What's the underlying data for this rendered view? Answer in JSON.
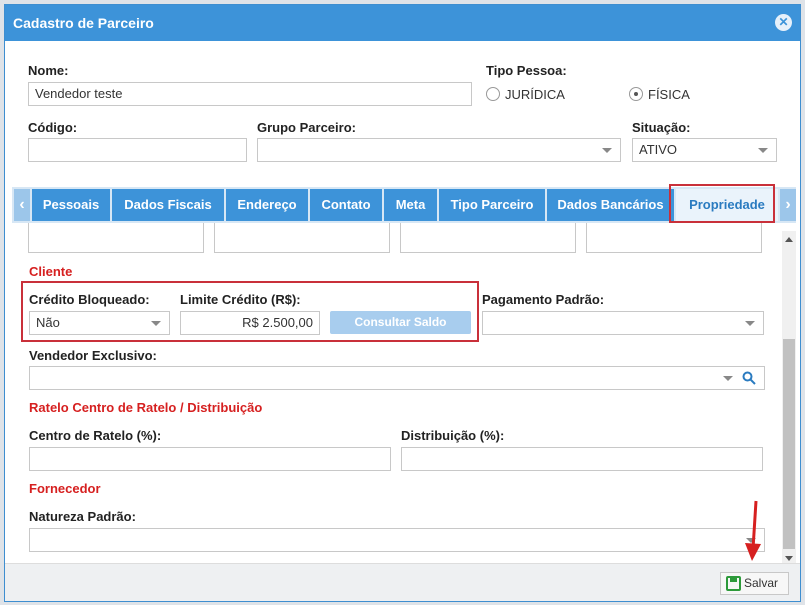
{
  "window": {
    "title": "Cadastro de Parceiro",
    "close_icon": "close-icon"
  },
  "form": {
    "nome": {
      "label": "Nome:",
      "value": "Vendedor teste"
    },
    "tipo_pessoa": {
      "label": "Tipo Pessoa:",
      "options": [
        "JURÍDICA",
        "FÍSICA"
      ],
      "selected": "FÍSICA"
    },
    "codigo": {
      "label": "Código:",
      "value": ""
    },
    "grupo_parceiro": {
      "label": "Grupo Parceiro:",
      "value": ""
    },
    "situacao": {
      "label": "Situação:",
      "value": "ATIVO"
    }
  },
  "tabs": [
    {
      "label": "Pessoais"
    },
    {
      "label": "Dados Fiscais"
    },
    {
      "label": "Endereço"
    },
    {
      "label": "Contato"
    },
    {
      "label": "Meta"
    },
    {
      "label": "Tipo Parceiro"
    },
    {
      "label": "Dados Bancários"
    },
    {
      "label": "Propriedade"
    }
  ],
  "active_tab": "Propriedade",
  "content": {
    "cliente": {
      "title": "Cliente",
      "credito_bloqueado": {
        "label": "Crédito Bloqueado:",
        "value": "Não"
      },
      "limite_credito": {
        "label": "Limite Crédito (R$):",
        "value": "R$ 2.500,00"
      },
      "consultar_saldo": "Consultar Saldo",
      "pagamento_padrao": {
        "label": "Pagamento Padrão:",
        "value": ""
      },
      "vendedor_exclusivo": {
        "label": "Vendedor Exclusivo:",
        "value": ""
      }
    },
    "rateio": {
      "title": "Ratelo Centro de Ratelo / Distribuição",
      "centro": {
        "label": "Centro de Ratelo (%):",
        "value": ""
      },
      "distribuicao": {
        "label": "Distribuição (%):",
        "value": ""
      }
    },
    "fornecedor": {
      "title": "Fornecedor",
      "natureza": {
        "label": "Natureza Padrão:",
        "value": ""
      }
    }
  },
  "footer": {
    "save_label": "Salvar"
  },
  "colors": {
    "header": "#3d93d9",
    "tab": "#3d93d9",
    "active_tab_bg": "#eaf3fb",
    "section_title": "#d62020",
    "highlight": "#c9303a",
    "save_icon": "#2d9a3a"
  }
}
